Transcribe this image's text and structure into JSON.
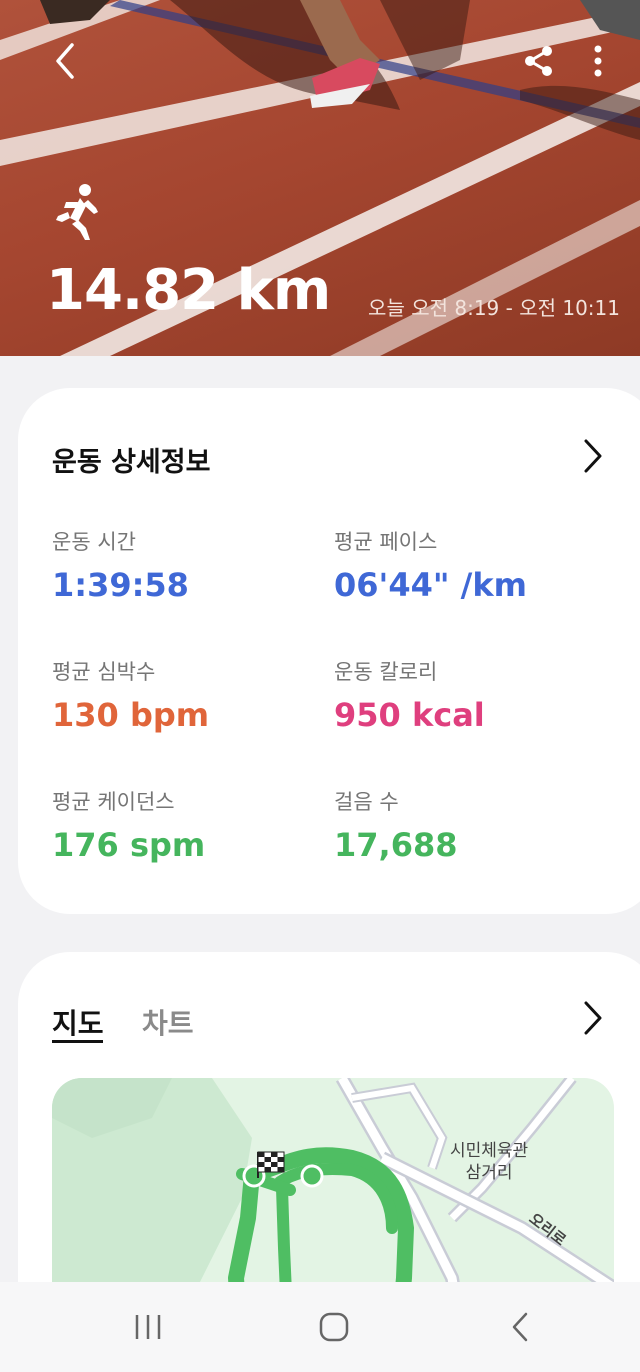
{
  "header": {
    "distance": "14.82 km",
    "time_range": "오늘 오전 8:19 - 오전 10:11",
    "icons": {
      "back": "back-icon",
      "share": "share-icon",
      "more": "more-vert-icon",
      "activity": "running-icon"
    }
  },
  "details": {
    "title": "운동 상세정보",
    "stats": [
      {
        "label": "운동 시간",
        "value": "1:39:58",
        "color": "#3f68d6"
      },
      {
        "label": "평균 페이스",
        "value": "06'44\" /km",
        "color": "#3f68d6"
      },
      {
        "label": "평균 심박수",
        "value": "130 bpm",
        "color": "#e0653a"
      },
      {
        "label": "운동 칼로리",
        "value": "950 kcal",
        "color": "#df3f7e"
      },
      {
        "label": "평균 케이던스",
        "value": "176 spm",
        "color": "#45b55d"
      },
      {
        "label": "걸음 수",
        "value": "17,688",
        "color": "#45b55d"
      }
    ]
  },
  "map_section": {
    "tabs": [
      "지도",
      "차트"
    ],
    "active_tab": "지도",
    "place_label_line1": "시민체육관",
    "place_label_line2": "삼거리",
    "road_label": "오리로",
    "route_color": "#4fbe63"
  },
  "navbar": {
    "icons": [
      "recent-apps-icon",
      "home-icon",
      "nav-back-icon"
    ]
  }
}
